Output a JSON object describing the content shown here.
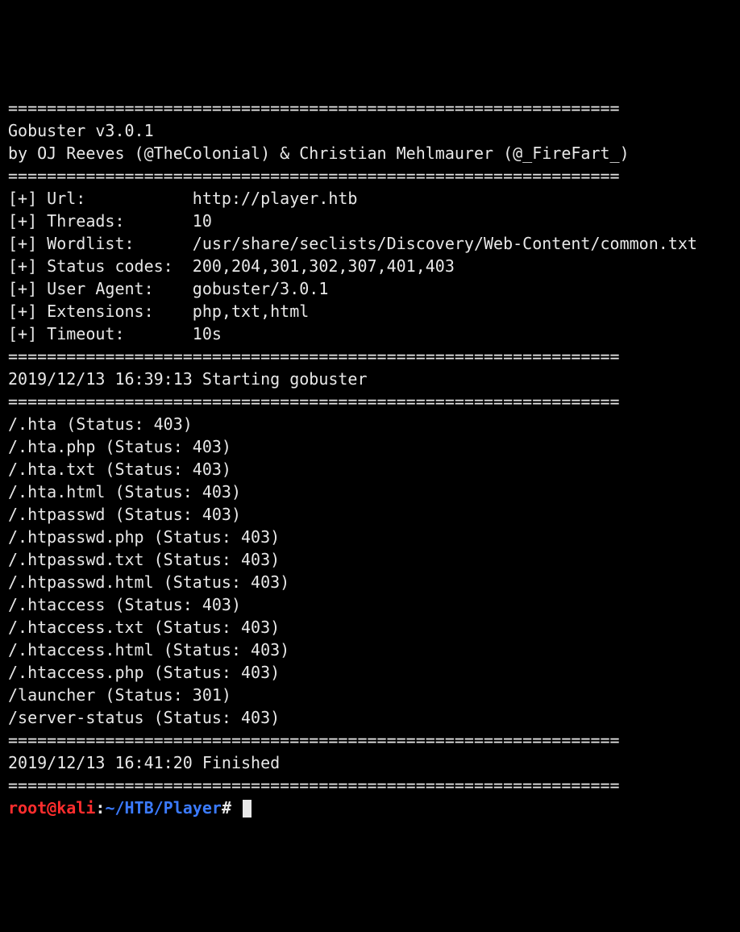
{
  "separator": "===============================================================",
  "header": {
    "title": "Gobuster v3.0.1",
    "byline": "by OJ Reeves (@TheColonial) & Christian Mehlmaurer (@_FireFart_)"
  },
  "config": [
    {
      "label": "Url:",
      "value": "http://player.htb"
    },
    {
      "label": "Threads:",
      "value": "10"
    },
    {
      "label": "Wordlist:",
      "value": "/usr/share/seclists/Discovery/Web-Content/common.txt"
    },
    {
      "label": "Status codes:",
      "value": "200,204,301,302,307,401,403"
    },
    {
      "label": "User Agent:",
      "value": "gobuster/3.0.1"
    },
    {
      "label": "Extensions:",
      "value": "php,txt,html"
    },
    {
      "label": "Timeout:",
      "value": "10s"
    }
  ],
  "start_line": "2019/12/13 16:39:13 Starting gobuster",
  "results": [
    "/.hta (Status: 403)",
    "/.hta.php (Status: 403)",
    "/.hta.txt (Status: 403)",
    "/.hta.html (Status: 403)",
    "/.htpasswd (Status: 403)",
    "/.htpasswd.php (Status: 403)",
    "/.htpasswd.txt (Status: 403)",
    "/.htpasswd.html (Status: 403)",
    "/.htaccess (Status: 403)",
    "/.htaccess.txt (Status: 403)",
    "/.htaccess.html (Status: 403)",
    "/.htaccess.php (Status: 403)",
    "/launcher (Status: 301)",
    "/server-status (Status: 403)"
  ],
  "finish_line": "2019/12/13 16:41:20 Finished",
  "prompt": {
    "user": "root",
    "at": "@",
    "host": "kali",
    "colon": ":",
    "path": "~/HTB/Player",
    "hash": "# "
  }
}
